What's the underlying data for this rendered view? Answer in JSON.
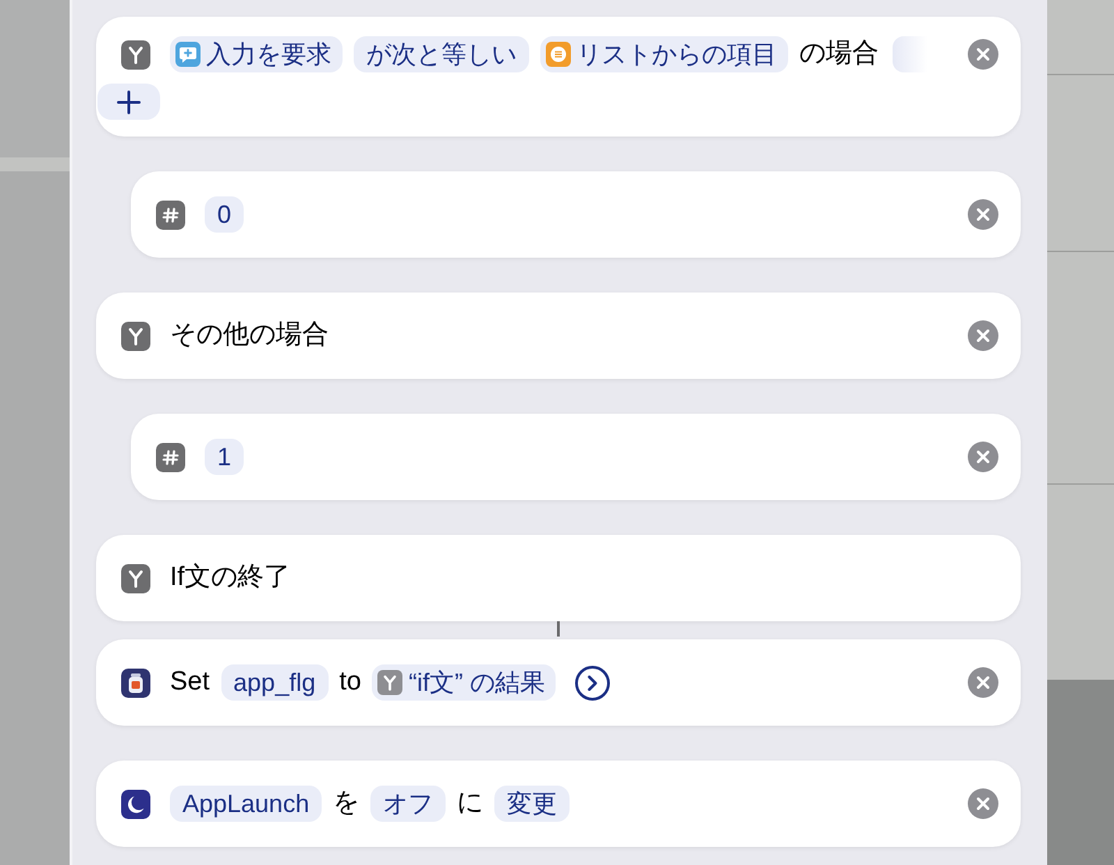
{
  "actions": [
    {
      "kind": "branch",
      "removable": true,
      "lines": [
        [
          {
            "kind": "prompt",
            "text": "入力を要求"
          },
          {
            "kind": "token",
            "text": "が次と等しい"
          },
          {
            "kind": "list",
            "text": "リストからの項目"
          },
          {
            "kind": "text",
            "text": "の場合"
          },
          {
            "kind": "fade"
          }
        ],
        [
          {
            "kind": "add"
          }
        ]
      ],
      "children": [
        {
          "kind": "number",
          "removable": true,
          "lines": [
            [
              {
                "kind": "token",
                "text": "0"
              }
            ]
          ]
        }
      ]
    },
    {
      "kind": "branch",
      "removable": true,
      "lines": [
        [
          {
            "kind": "text",
            "text": "その他の場合"
          }
        ]
      ],
      "children": [
        {
          "kind": "number",
          "removable": true,
          "lines": [
            [
              {
                "kind": "token",
                "text": "1"
              }
            ]
          ]
        }
      ]
    },
    {
      "kind": "branch",
      "removable": false,
      "connector": true,
      "lines": [
        [
          {
            "kind": "text",
            "text": "If文の終了"
          }
        ]
      ]
    },
    {
      "kind": "variable",
      "removable": true,
      "lines": [
        [
          {
            "kind": "text",
            "text": "Set"
          },
          {
            "kind": "token",
            "text": "app_flg"
          },
          {
            "kind": "text",
            "text": "to"
          },
          {
            "kind": "result",
            "text": "“if文” の結果"
          },
          {
            "kind": "chevron"
          }
        ]
      ]
    },
    {
      "kind": "focus",
      "removable": true,
      "lines": [
        [
          {
            "kind": "token",
            "text": "AppLaunch"
          },
          {
            "kind": "text",
            "text": "を"
          },
          {
            "kind": "token",
            "text": "オフ"
          },
          {
            "kind": "text",
            "text": "に"
          },
          {
            "kind": "token",
            "text": "変更"
          }
        ]
      ]
    }
  ]
}
